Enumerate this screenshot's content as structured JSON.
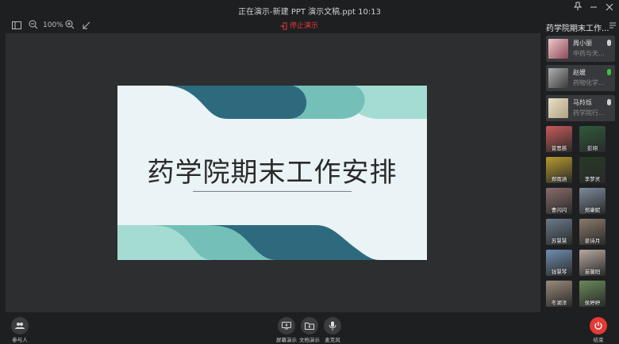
{
  "window": {
    "title": "正在演示-新建 PPT 演示文稿.ppt 10:13"
  },
  "toolbar": {
    "zoom": "100%",
    "stop_label": "停止演示"
  },
  "slide": {
    "title": "药学院期末工作安排",
    "colors": {
      "dark": "#2e6a7e",
      "mid": "#74c0b9",
      "light": "#a4dcd4",
      "background": "#eaf3f5"
    }
  },
  "panel": {
    "title": "药学院期末工作...",
    "speakers": [
      {
        "name": "周小丽",
        "sub": "中药与天...",
        "mic": "gray"
      },
      {
        "name": "赵媛",
        "sub": "药物化学...",
        "mic": "green"
      },
      {
        "name": "马羚烁",
        "sub": "药学院行...",
        "mic": "gray"
      }
    ],
    "attendees": [
      {
        "name": "曾思慈",
        "color": "#c95a5a"
      },
      {
        "name": "彭翊",
        "color": "#2f5a3a"
      },
      {
        "name": "郑雨涵",
        "color": "#b89a2e"
      },
      {
        "name": "李梦灵",
        "color": "#263a26"
      },
      {
        "name": "曹闪闪",
        "color": "#8a6b6b"
      },
      {
        "name": "郑康妮",
        "color": "#7c8a9a"
      },
      {
        "name": "苏慧慧",
        "color": "#6a7a8a"
      },
      {
        "name": "姜诗月",
        "color": "#8a7a6a"
      },
      {
        "name": "钱慧琴",
        "color": "#6f8fb0"
      },
      {
        "name": "苗馨阳",
        "color": "#b8a8a0"
      },
      {
        "name": "冬湖洋",
        "color": "#9a8a7a"
      },
      {
        "name": "侯婷婷",
        "color": "#6a8a5a"
      }
    ]
  },
  "bottom": {
    "participants": "参与人",
    "screen_share": "屏幕演示",
    "doc_share": "文档演示",
    "mic": "麦克风",
    "end": "结束"
  }
}
